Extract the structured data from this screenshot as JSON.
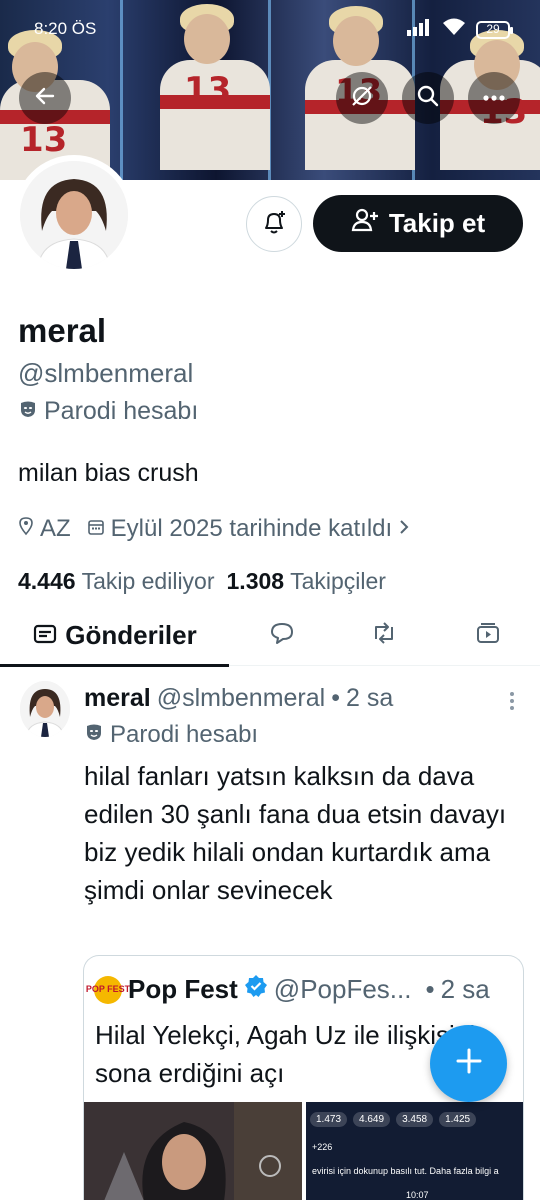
{
  "status_bar": {
    "time": "8:20 ÖS",
    "battery": "29"
  },
  "profile": {
    "name": "meral",
    "handle": "@slmbenmeral",
    "parody_label": "Parodi hesabı",
    "bio": "milan bias crush",
    "location": "AZ",
    "joined": "Eylül 2025 tarihinde katıldı",
    "following_count": "4.446",
    "following_label": "Takip ediliyor",
    "followers_count": "1.308",
    "followers_label": "Takipçiler",
    "follow_button": "Takip et"
  },
  "banner": {
    "jersey_number": "13"
  },
  "tabs": {
    "active_label": "Gönderiler"
  },
  "post": {
    "name": "meral",
    "handle": "@slmbenmeral",
    "separator": "•",
    "time": "2 sa",
    "parody_label": "Parodi hesabı",
    "text": "hilal fanları yatsın kalksın da dava edilen 30 şanlı fana dua etsin davayı biz yedik hilali ondan kurtardık ama şimdi onlar sevinecek",
    "quote": {
      "logo_text": "POP FEST",
      "name": "Pop Fest",
      "handle": "@PopFes...",
      "separator": "•",
      "time": "2 sa",
      "text": "Hilal Yelekçi, Agah Uz ile ilişkisinin sona erdiğini açı",
      "reactions": [
        "1.473",
        "4.649",
        "3.458",
        "1.425"
      ],
      "extra_count": "+226",
      "overlay_text": "evirisi için dokunup basılı tut. Daha fazla bilgi a",
      "overlay_time": "10:07"
    }
  },
  "colors": {
    "accent": "#1d9bf0",
    "text": "#0f1419",
    "secondary": "#536471"
  }
}
